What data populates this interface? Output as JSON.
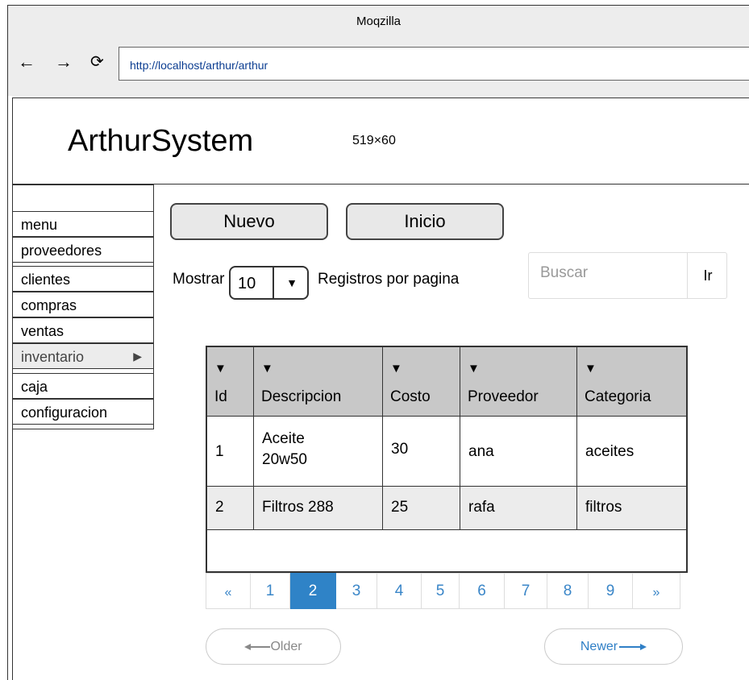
{
  "browser": {
    "title": "Moqzilla",
    "back_icon": "←",
    "forward_icon": "→",
    "reload_icon": "⟳",
    "url": "http://localhost/arthur/arthur"
  },
  "header": {
    "brand": "ArthurSystem",
    "image_size_label": "519×60"
  },
  "sidebar": {
    "items": [
      {
        "label": "menu"
      },
      {
        "label": "proveedores"
      },
      {
        "label": "clientes"
      },
      {
        "label": "compras"
      },
      {
        "label": "ventas"
      },
      {
        "label": "inventario",
        "arrow": "▶",
        "selected": true
      },
      {
        "label": "caja"
      },
      {
        "label": "configuracion"
      }
    ]
  },
  "toolbar": {
    "new_label": "Nuevo",
    "home_label": "Inicio"
  },
  "paging_options": {
    "show_label": "Mostrar",
    "page_size": "10",
    "dropdown_arrow": "▼",
    "records_label": "Registros por pagina"
  },
  "search": {
    "placeholder": "Buscar",
    "button_label": "Ir"
  },
  "table": {
    "sort_icon": "▼",
    "columns": [
      "Id",
      "Descripcion",
      "Costo",
      "Proveedor",
      "Categoria"
    ],
    "rows": [
      [
        "1",
        "Aceite 20w50",
        "30",
        "ana",
        "aceites"
      ],
      [
        "2",
        "Filtros 288",
        "25",
        "rafa",
        "filtros"
      ]
    ]
  },
  "pagination": {
    "prev": "«",
    "pages": [
      "1",
      "2",
      "3",
      "4",
      "5",
      "6",
      "7",
      "8",
      "9"
    ],
    "active_page": "2",
    "next": "»"
  },
  "nav_buttons": {
    "older": "Older",
    "newer": "Newer"
  }
}
